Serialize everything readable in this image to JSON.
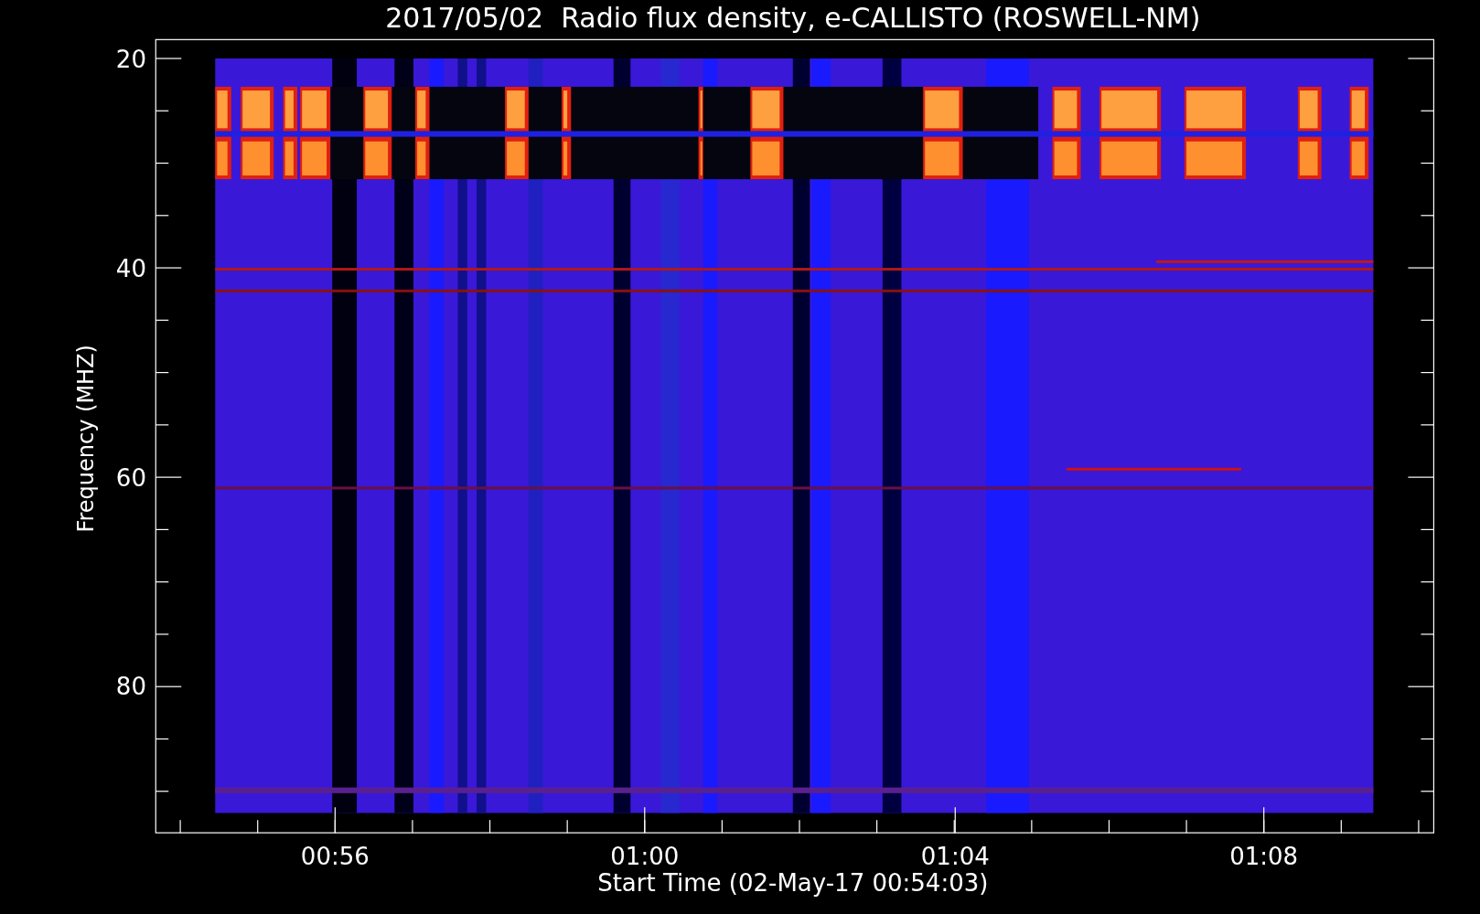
{
  "title": "2017/05/02  Radio flux density, e-CALLISTO (ROSWELL-NM)",
  "y_axis": {
    "label": "Frequency (MHZ)",
    "ticks": [
      "20",
      "40",
      "60",
      "80"
    ]
  },
  "x_axis": {
    "label": "Start Time (02-May-17 00:54:03)",
    "ticks": [
      "00:56",
      "01:00",
      "01:04",
      "01:08"
    ]
  }
}
